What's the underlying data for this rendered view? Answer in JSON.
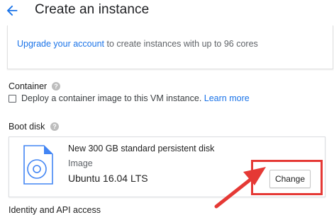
{
  "header": {
    "title": "Create an instance",
    "back_icon": "arrow-back-icon"
  },
  "upgrade": {
    "link_text": "Upgrade your account",
    "rest_text": " to create instances with up to 96 cores"
  },
  "container": {
    "label": "Container",
    "checkbox_checked": false,
    "checkbox_text": "Deploy a container image to this VM instance.",
    "learn_more": "Learn more"
  },
  "boot_disk": {
    "label": "Boot disk",
    "title": "New 300 GB standard persistent disk",
    "image_label": "Image",
    "image_value": "Ubuntu 16.04 LTS",
    "change_label": "Change"
  },
  "next_section": {
    "label_partial": "Identity and API access"
  },
  "colors": {
    "accent": "#1a73e8",
    "annotation_red": "#e53935"
  }
}
